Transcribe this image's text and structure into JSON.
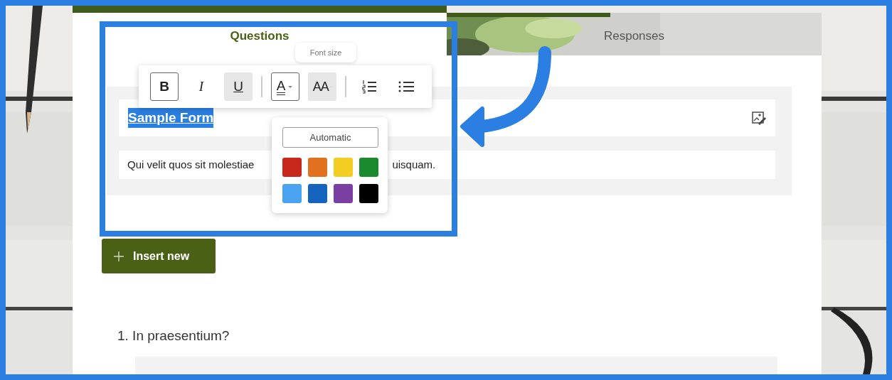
{
  "tabs": [
    {
      "label": "Questions",
      "selected": true
    },
    {
      "label": "Responses",
      "selected": false
    }
  ],
  "toolbar": {
    "tools": [
      {
        "kind": "bold",
        "label": "B",
        "active": true,
        "highlighted": false,
        "dropdown": false
      },
      {
        "kind": "italic",
        "label": "I",
        "active": false,
        "highlighted": false,
        "dropdown": false
      },
      {
        "kind": "underline",
        "label": "U",
        "active": false,
        "highlighted": true,
        "dropdown": false
      },
      {
        "kind": "separator"
      },
      {
        "kind": "font-color",
        "label": "A",
        "active": true,
        "highlighted": false,
        "dropdown": true
      },
      {
        "kind": "font-size",
        "label": "AA",
        "active": false,
        "highlighted": true,
        "dropdown": true
      },
      {
        "kind": "separator"
      },
      {
        "kind": "numbered-list",
        "active": false,
        "highlighted": false,
        "dropdown": false
      },
      {
        "kind": "bullet-list",
        "active": false,
        "highlighted": false,
        "dropdown": false
      }
    ]
  },
  "tooltip": {
    "text": "Font size"
  },
  "color_menu": {
    "automatic": "Automatic",
    "swatches": [
      {
        "color": "#c8281c"
      },
      {
        "color": "#e2701e"
      },
      {
        "color": "#f3cd22"
      },
      {
        "color": "#1b8a2c"
      },
      {
        "color": "#4aa3f0"
      },
      {
        "color": "#1464c0"
      },
      {
        "color": "#7b3fa4"
      },
      {
        "color": "#000000"
      }
    ]
  },
  "form": {
    "title": "Sample Form",
    "title_selected": true,
    "description_parts": [
      "Qui velit quos sit molestiae",
      "uisquam."
    ]
  },
  "insert_button": "Insert new",
  "question": {
    "title": "1. In praesentium?"
  }
}
